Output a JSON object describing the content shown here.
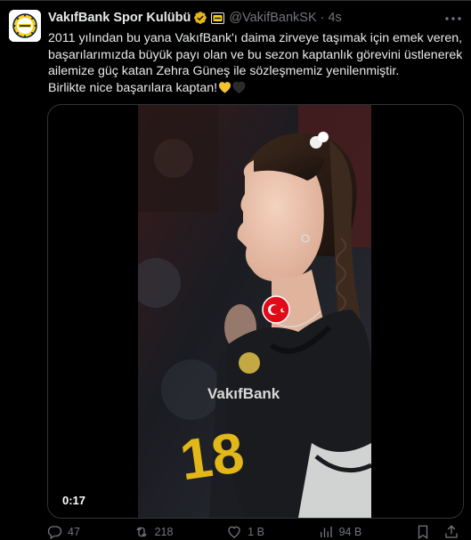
{
  "tweet": {
    "display_name": "VakıfBank Spor Kulübü",
    "handle": "@VakifBankSK",
    "separator": "·",
    "time": "4s",
    "text_lines": [
      "2011 yılından bu yana VakıfBank'ı daima zirveye taşımak için emek veren,",
      "başarılarımızda büyük payı olan ve bu sezon kaptanlık görevini üstlenerek",
      "ailemize güç katan Zehra Güneş ile sözleşmemiz yenilenmiştir.",
      "Birlikte nice başarılara kaptan!"
    ],
    "emoji": [
      "yellow-heart",
      "black-heart"
    ]
  },
  "media": {
    "duration": "0:17",
    "jersey_text": "VakıfBank",
    "jersey_number": "18"
  },
  "actions": {
    "reply_count": "47",
    "retweet_count": "218",
    "like_count": "1 B",
    "views_count": "94 B"
  },
  "colors": {
    "background": "#000000",
    "text_primary": "#e7e9ea",
    "text_secondary": "#71767b",
    "verified_gold": "#e2b719",
    "border": "#2f3336"
  },
  "icons": {
    "avatar": "vakifbank-club-logo",
    "verified": "gold-verified-badge-icon",
    "affiliate": "affiliate-badge-icon",
    "more": "more-dots-icon",
    "reply": "reply-icon",
    "retweet": "retweet-icon",
    "like": "heart-icon",
    "views": "views-chart-icon",
    "bookmark": "bookmark-icon",
    "share": "share-icon"
  }
}
